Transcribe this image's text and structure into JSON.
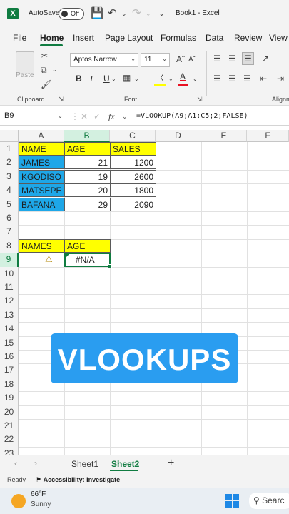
{
  "titlebar": {
    "autosave_label": "AutoSave",
    "toggle_label": "Off",
    "doc_title": "Book1  -  Excel"
  },
  "menu": {
    "items": [
      "File",
      "Home",
      "Insert",
      "Page Layout",
      "Formulas",
      "Data",
      "Review",
      "View"
    ],
    "active": "Home"
  },
  "ribbon": {
    "paste_label": "Paste",
    "clipboard_label": "Clipboard",
    "font_label": "Font",
    "align_label": "Alignm",
    "font_name": "Aptos Narrow",
    "font_size": "11",
    "bold": "B",
    "italic": "I",
    "underline": "U",
    "font_color_letter": "A"
  },
  "formula_bar": {
    "name_box": "B9",
    "fx": "fx",
    "formula": "=VLOOKUP(A9;A1:C5;2;FALSE)"
  },
  "grid": {
    "columns": [
      "A",
      "B",
      "C",
      "D",
      "E",
      "F"
    ],
    "rows": [
      "1",
      "2",
      "3",
      "4",
      "5",
      "6",
      "7",
      "8",
      "9",
      "10",
      "11",
      "12",
      "13",
      "14",
      "15",
      "16",
      "17",
      "18",
      "19",
      "20",
      "21",
      "22",
      "23"
    ],
    "cells": {
      "A1": "NAME",
      "B1": "AGE",
      "C1": "SALES",
      "A2": "JAMES",
      "B2": "21",
      "C2": "1200",
      "A3": "KGODISO",
      "B3": "19",
      "C3": "2600",
      "A4": "MATSEPE",
      "B4": "20",
      "C4": "1800",
      "A5": "BAFANA",
      "B5": "29",
      "C5": "2090",
      "A8": "NAMES",
      "B8": "AGE",
      "B9": "#N/A"
    }
  },
  "banner": {
    "text": "VLOOKUPS"
  },
  "sheets": {
    "tabs": [
      "Sheet1",
      "Sheet2"
    ],
    "active": "Sheet2"
  },
  "status": {
    "ready": "Ready",
    "accessibility": "Accessibility: Investigate"
  },
  "taskbar": {
    "temp": "66°F",
    "weather": "Sunny",
    "search": "Searc"
  },
  "colors": {
    "excel_green": "#107c41",
    "header_yellow": "#ffff00",
    "name_blue": "#1ea7e8",
    "banner_blue": "#2a9df0"
  }
}
